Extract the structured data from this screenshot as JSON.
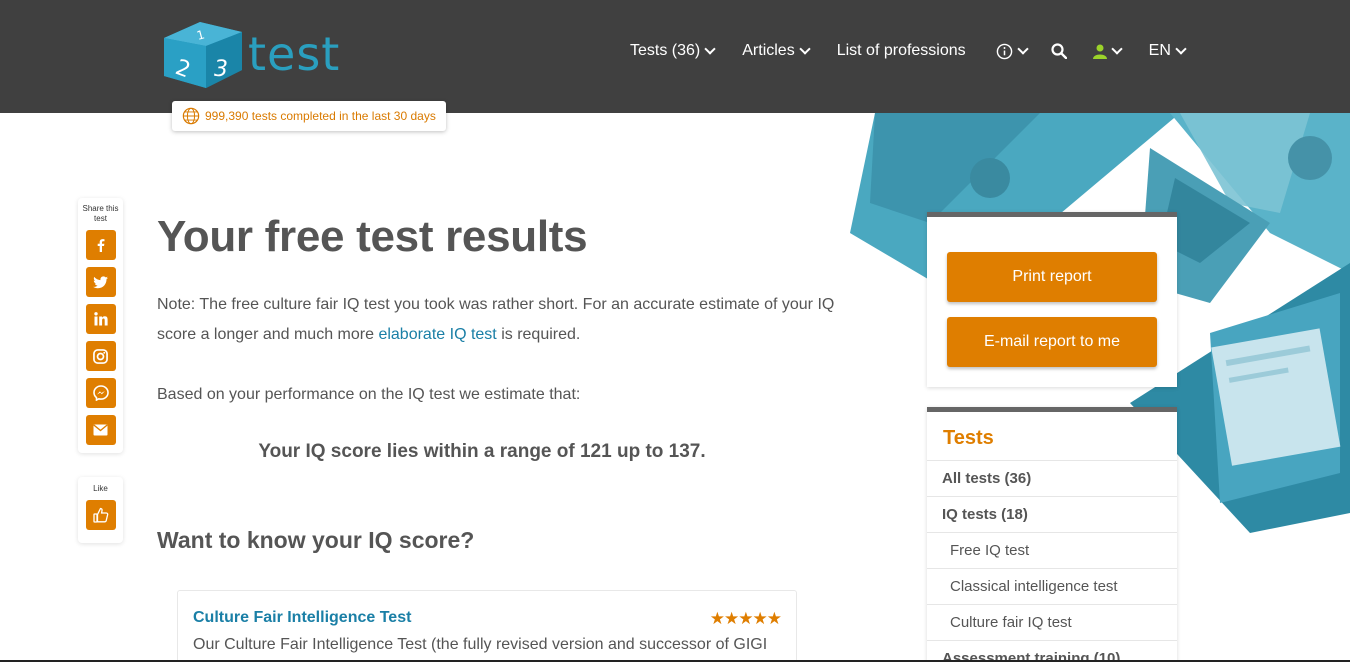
{
  "header": {
    "logo_text": "test",
    "counter": "999,390 tests completed in the last 30 days",
    "nav": [
      {
        "label": "Tests (36)",
        "dropdown": true
      },
      {
        "label": "Articles",
        "dropdown": true
      },
      {
        "label": "List of professions",
        "dropdown": false
      }
    ],
    "info_icon": "info-icon",
    "search_icon": "search-icon",
    "user_icon": "user-icon",
    "language": "EN"
  },
  "share": {
    "title": "Share this test",
    "buttons": [
      "facebook-icon",
      "twitter-icon",
      "linkedin-icon",
      "instagram-icon",
      "messenger-icon",
      "email-icon"
    ],
    "like_label": "Like"
  },
  "main": {
    "title": "Your free test results",
    "note_before": "Note: The free culture fair IQ test you took was rather short. For an accurate estimate of your IQ score a longer and much more ",
    "note_link": "elaborate IQ test",
    "note_after": " is required.",
    "based": "Based on your performance on the IQ test we estimate that:",
    "score": "Your IQ score lies within a range of 121 up to 137.",
    "subhead": "Want to know your IQ score?",
    "card": {
      "title": "Culture Fair Intelligence Test",
      "stars": "★★★★★",
      "rating": 5,
      "description": "Our Culture Fair Intelligence Test (the fully revised version and successor of GIGI"
    }
  },
  "report": {
    "print_label": "Print report",
    "email_label": "E-mail report to me"
  },
  "tests_panel": {
    "heading": "Tests",
    "items": [
      {
        "label": "All tests (36)",
        "level": "main"
      },
      {
        "label": "IQ tests (18)",
        "level": "main"
      },
      {
        "label": "Free IQ test",
        "level": "sub"
      },
      {
        "label": "Classical intelligence test",
        "level": "sub"
      },
      {
        "label": "Culture fair IQ test",
        "level": "sub"
      },
      {
        "label": "Assessment training (10)",
        "level": "main"
      }
    ]
  },
  "colors": {
    "header_bg": "#404040",
    "accent_orange": "#df7e00",
    "link_blue": "#1a7fa6",
    "logo_blue": "#2a9fbf"
  }
}
